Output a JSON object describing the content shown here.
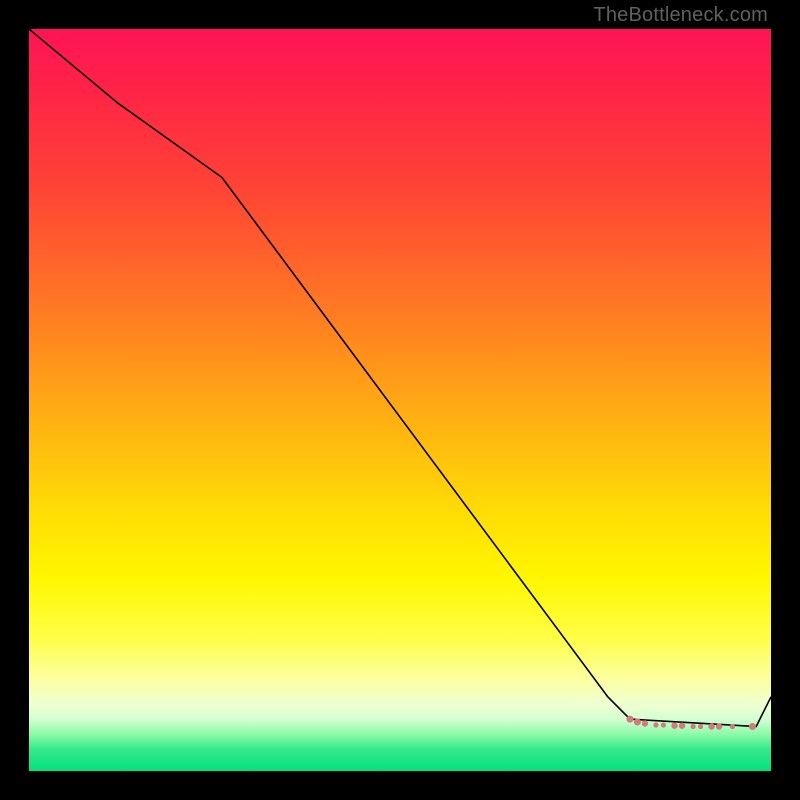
{
  "attribution": "TheBottleneck.com",
  "colors": {
    "background": "#000000",
    "gradient_top": "#ff1356",
    "gradient_bottom": "#00e27f",
    "line": "#000000",
    "marker_fill": "#d47a7a",
    "attribution_text": "#606060"
  },
  "chart_data": {
    "type": "line",
    "title": "",
    "xlabel": "",
    "ylabel": "",
    "xlim": [
      0,
      100
    ],
    "ylim": [
      0,
      100
    ],
    "grid": false,
    "series": [
      {
        "name": "curve",
        "x": [
          0,
          12,
          26,
          78,
          81,
          98,
          100
        ],
        "y": [
          100,
          90,
          80,
          10,
          7,
          6,
          10
        ],
        "stroke": "#000000",
        "stroke_width": 1.6
      }
    ],
    "markers": {
      "name": "highlighted-region",
      "fill": "#d47a7a",
      "points": [
        {
          "x": 81.0,
          "y": 7.0,
          "r": 3.5
        },
        {
          "x": 82.0,
          "y": 6.6,
          "r": 3.5
        },
        {
          "x": 83.0,
          "y": 6.4,
          "r": 3.2
        },
        {
          "x": 84.5,
          "y": 6.2,
          "r": 2.6
        },
        {
          "x": 85.5,
          "y": 6.2,
          "r": 2.6
        },
        {
          "x": 87.0,
          "y": 6.1,
          "r": 3.2
        },
        {
          "x": 88.0,
          "y": 6.1,
          "r": 3.2
        },
        {
          "x": 89.5,
          "y": 6.0,
          "r": 2.6
        },
        {
          "x": 90.5,
          "y": 6.0,
          "r": 2.6
        },
        {
          "x": 92.0,
          "y": 6.0,
          "r": 3.2
        },
        {
          "x": 93.0,
          "y": 6.0,
          "r": 3.2
        },
        {
          "x": 94.8,
          "y": 6.0,
          "r": 2.6
        },
        {
          "x": 97.5,
          "y": 6.0,
          "r": 3.5
        }
      ]
    }
  }
}
